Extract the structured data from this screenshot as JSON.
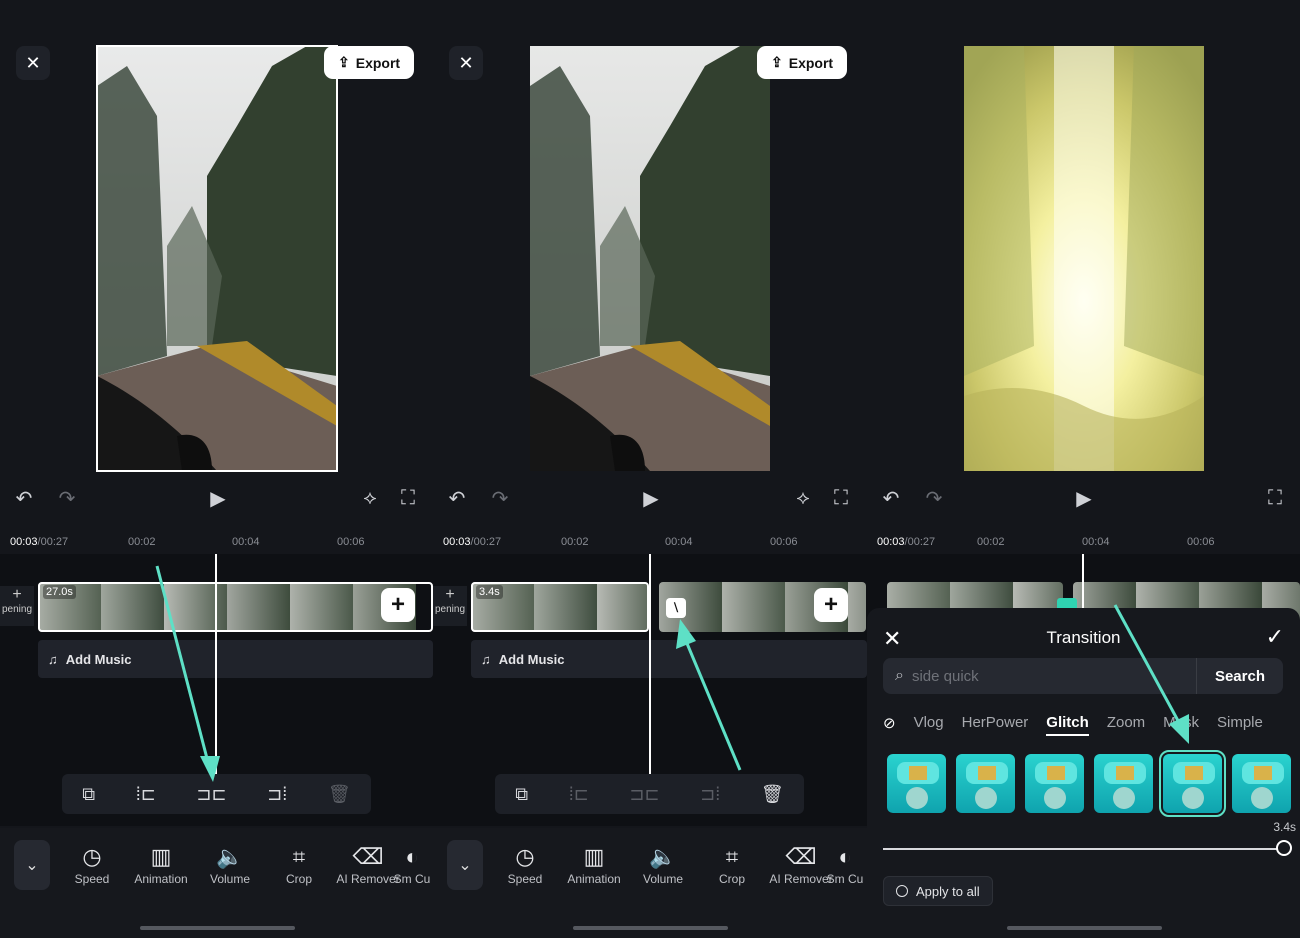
{
  "panels": [
    {
      "export_label": "Export",
      "ruler": {
        "current": "00:03",
        "total": "/00:27",
        "ticks": [
          "00:02",
          "00:04",
          "00:06"
        ]
      },
      "clip_duration": "27.0s",
      "track_label": "pening",
      "add_music_label": "Add Music"
    },
    {
      "export_label": "Export",
      "ruler": {
        "current": "00:03",
        "total": "/00:27",
        "ticks": [
          "00:02",
          "00:04",
          "00:06"
        ]
      },
      "clip_duration": "3.4s",
      "track_label": "pening",
      "add_music_label": "Add Music"
    },
    {
      "ruler": {
        "current": "00:03",
        "total": "/00:27",
        "ticks": [
          "00:02",
          "00:04",
          "00:06"
        ]
      }
    }
  ],
  "bottom_tools": [
    "Speed",
    "Animation",
    "Volume",
    "Crop",
    "AI Remover",
    "Sm Cu"
  ],
  "transition": {
    "title": "Transition",
    "search_placeholder": "side quick",
    "search_button": "Search",
    "categories": [
      "Vlog",
      "HerPower",
      "Glitch",
      "Zoom",
      "Mask",
      "Simple"
    ],
    "active_category": "Glitch",
    "duration": "3.4s",
    "apply_all": "Apply to all"
  },
  "colors": {
    "accent_arrow": "#5ee0c6",
    "panel_bg": "#14161b",
    "timeline_bg": "#0e1014"
  }
}
